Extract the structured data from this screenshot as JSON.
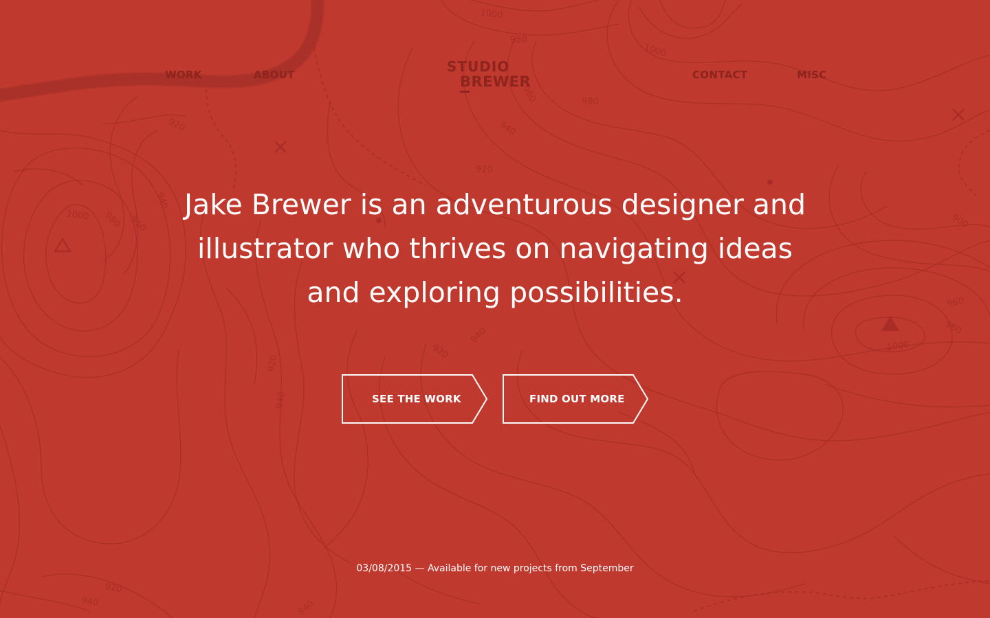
{
  "nav": {
    "work": "WORK",
    "about": "ABOUT",
    "contact": "CONTACT",
    "misc": "MISC"
  },
  "logo": {
    "line1": "STUDIO",
    "line2": "BREWER"
  },
  "hero": {
    "line1": "Jake Brewer is an adventurous designer and",
    "line2": "illustrator who thrives on navigating ideas",
    "line3": "and exploring possibilities."
  },
  "buttons": {
    "see_work": "SEE THE WORK",
    "find_out_more": "FIND OUT MORE"
  },
  "footer": {
    "note": "03/08/2015 — Available for new projects from September"
  },
  "map_labels": {
    "a": "1000",
    "b": "980",
    "c": "1000",
    "d": "980",
    "e": "940",
    "f": "920",
    "g": "920",
    "h": "940",
    "i": "1000",
    "j": "980",
    "k": "960",
    "l": "900",
    "m": "960",
    "n": "980",
    "o": "1000",
    "p": "920",
    "q": "940",
    "r": "920",
    "s": "940",
    "t": "920",
    "u": "940",
    "v": "940",
    "w": "960"
  },
  "colors": {
    "background": "#c0392f",
    "topo_line": "#a52c24",
    "nav_text": "#8d241d",
    "hero_text": "#ffffff"
  },
  "icons": {
    "map_markers": [
      "x-marker-icon",
      "triangle-marker-icon",
      "summit-icon",
      "dot-marker-icon"
    ]
  }
}
